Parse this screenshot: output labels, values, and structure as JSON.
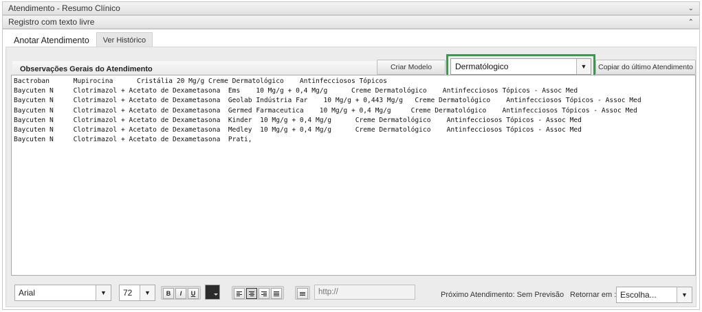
{
  "header1": {
    "title": "Atendimento - Resumo Clínico",
    "icon": "chevron-down-icon"
  },
  "header2": {
    "title": "Registro com texto livre",
    "icon": "chevron-up-icon"
  },
  "tabs": [
    {
      "label": "Anotar Atendimento",
      "active": true
    },
    {
      "label": "Ver Histórico",
      "active": false
    }
  ],
  "section": {
    "title": "Observações Gerais do Atendimento",
    "criar_modelo": "Criar Modelo",
    "model_select": "Dermatólogico",
    "copiar": "Copiar do último Atendimento"
  },
  "editor": {
    "lines": [
      "Bactroban      Mupirocina      Cristália 20 Mg/g Creme Dermatológico    Antinfecciosos Tópicos",
      "Baycuten N     Clotrimazol + Acetato de Dexametasona  Ems    10 Mg/g + 0,4 Mg/g      Creme Dermatológico    Antinfecciosos Tópicos - Assoc Med",
      "Baycuten N     Clotrimazol + Acetato de Dexametasona  Geolab Indústria Far    10 Mg/g + 0,443 Mg/g   Creme Dermatológico    Antinfecciosos Tópicos - Assoc Med",
      "Baycuten N     Clotrimazol + Acetato de Dexametasona  Germed Farmaceutica    10 Mg/g + 0,4 Mg/g     Creme Dermatológico    Antinfecciosos Tópicos - Assoc Med",
      "Baycuten N     Clotrimazol + Acetato de Dexametasona  Kinder  10 Mg/g + 0,4 Mg/g      Creme Dermatológico    Antinfecciosos Tópicos - Assoc Med",
      "Baycuten N     Clotrimazol + Acetato de Dexametasona  Medley  10 Mg/g + 0,4 Mg/g      Creme Dermatológico    Antinfecciosos Tópicos - Assoc Med",
      "Baycuten N     Clotrimazol + Acetato de Dexametasona  Prati,"
    ]
  },
  "toolbar": {
    "font": "Arial",
    "size": "72",
    "bold": "B",
    "italic": "I",
    "underline": "U",
    "text_color": "#2b2b2b",
    "url_placeholder": "http://",
    "proximo": "Próximo Atendimento: Sem Previsão",
    "retornar": "Retornar em :",
    "escolha": "Escolha..."
  },
  "accent": {
    "highlight": "#24a640"
  }
}
